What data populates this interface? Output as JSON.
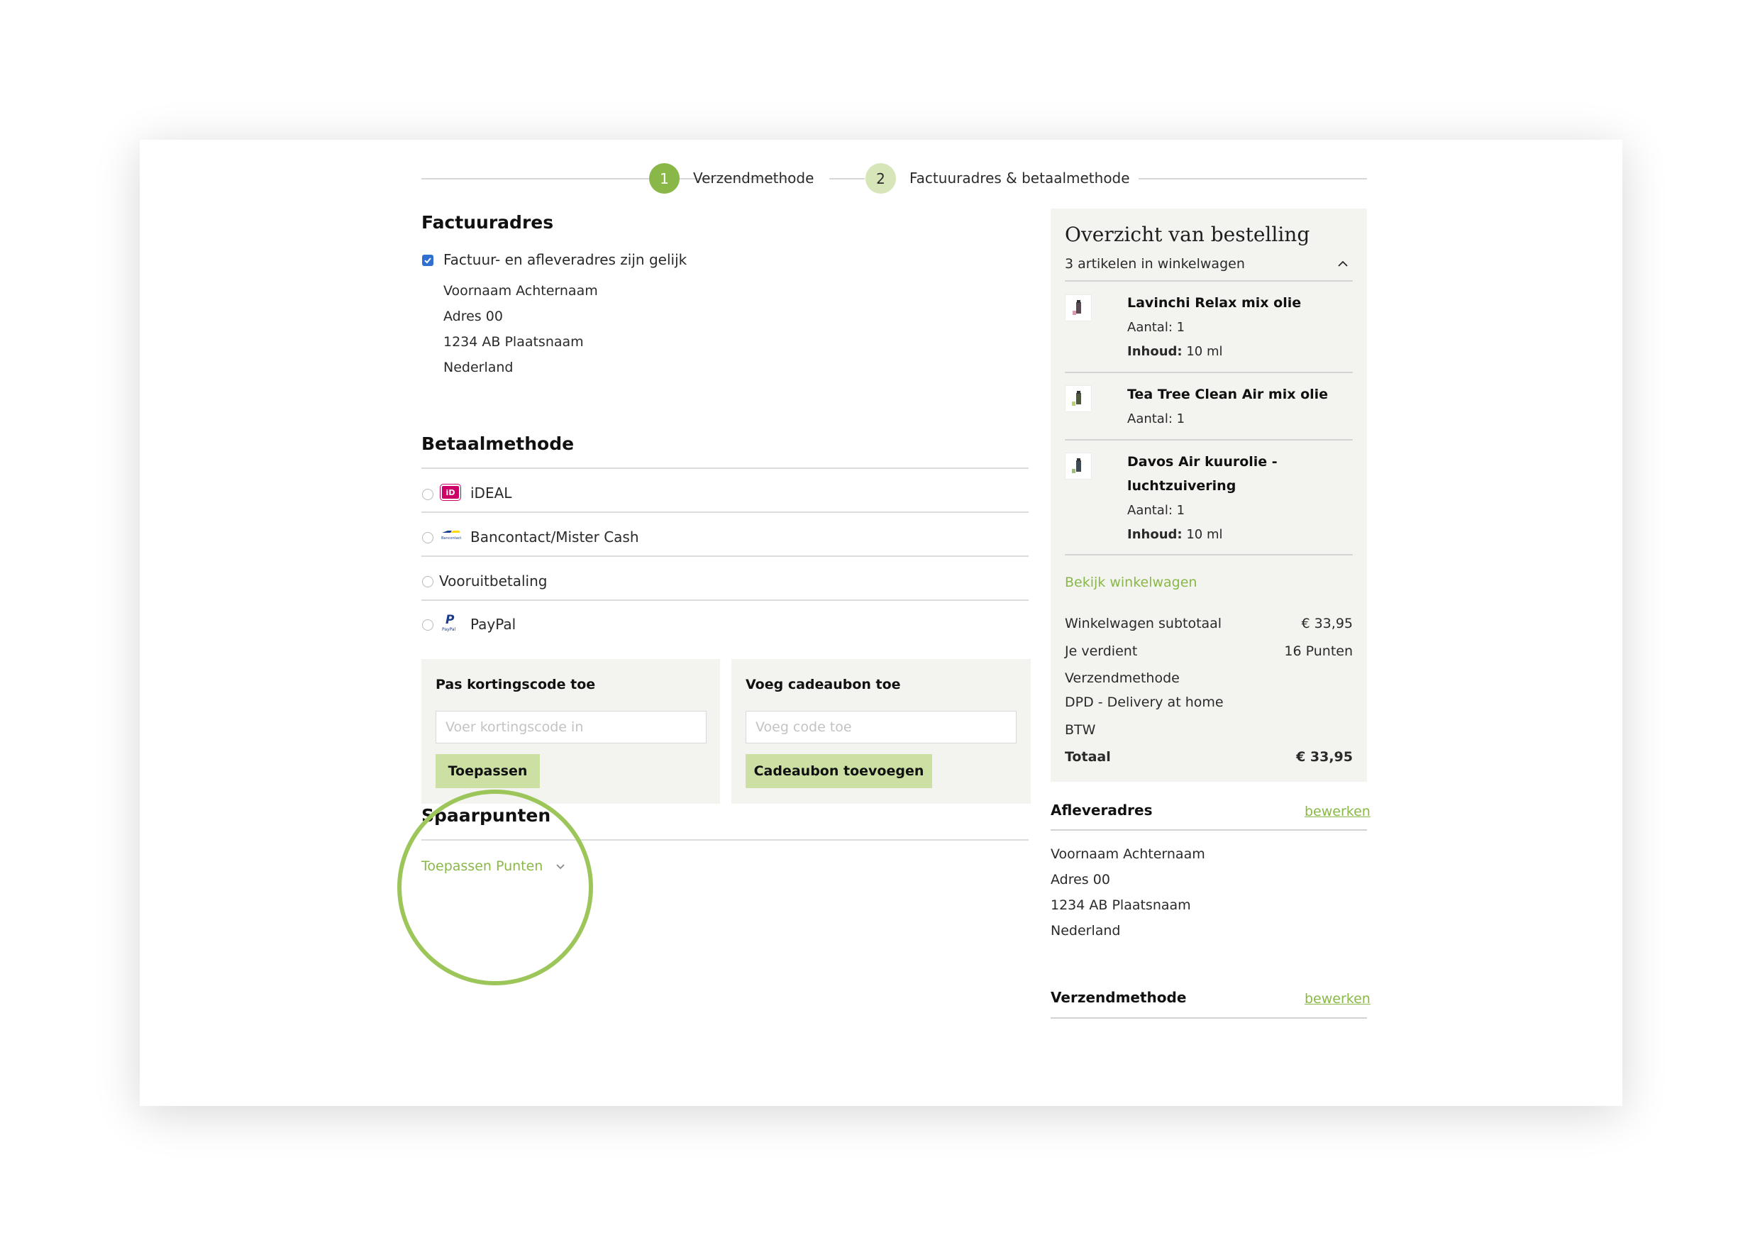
{
  "colors": {
    "accent": "#8ab848",
    "accent_light": "#cde0a4",
    "panel": "#f3f3f0",
    "checkbox": "#2f6fd1"
  },
  "progress": {
    "steps": [
      {
        "number": "1",
        "label": "Verzendmethode"
      },
      {
        "number": "2",
        "label": "Factuuradres & betaalmethode"
      }
    ]
  },
  "billing": {
    "title": "Factuuradres",
    "same_address_label": "Factuur- en afleveradres zijn gelijk",
    "address": [
      "Voornaam Achternaam",
      "Adres 00",
      "1234 AB Plaatsnaam",
      "Nederland"
    ]
  },
  "payment": {
    "title": "Betaalmethode",
    "methods": [
      {
        "label": "iDEAL",
        "icon": "ideal-icon"
      },
      {
        "label": "Bancontact/Mister Cash",
        "icon": "bancontact-icon"
      },
      {
        "label": "Vooruitbetaling",
        "icon": ""
      },
      {
        "label": "PayPal",
        "icon": "paypal-icon"
      }
    ],
    "icon_text": {
      "ideal": "iD",
      "bancontact": "Bancontact",
      "paypal_brand": "P",
      "paypal_text": "PayPal"
    }
  },
  "discount": {
    "title": "Pas kortingscode toe",
    "placeholder": "Voer kortingscode in",
    "button": "Toepassen"
  },
  "giftcard": {
    "title": "Voeg cadeaubon toe",
    "placeholder": "Voeg code toe",
    "button": "Cadeaubon toevoegen"
  },
  "points": {
    "title": "Spaarpunten",
    "apply_label": "Toepassen Punten"
  },
  "summary": {
    "title": "Overzicht van bestelling",
    "items_count": "3 artikelen in winkelwagen",
    "items": [
      {
        "name_lines": [
          "Lavinchi Relax mix olie"
        ],
        "qty": "Aantal: 1",
        "content_label": "Inhoud:",
        "content_value": "10 ml"
      },
      {
        "name_lines": [
          "Tea Tree Clean Air mix olie"
        ],
        "qty": "Aantal: 1"
      },
      {
        "name_lines": [
          "Davos Air kuurolie -",
          "luchtzuivering"
        ],
        "qty": "Aantal: 1",
        "content_label": "Inhoud:",
        "content_value": "10 ml"
      }
    ],
    "view_cart": "Bekijk winkelwagen",
    "totals": {
      "subtotal_label": "Winkelwagen subtotaal",
      "subtotal_value": "€ 33,95",
      "earn_label": "Je verdient",
      "earn_value": "16 Punten",
      "shipping_label": "Verzendmethode",
      "shipping_value": "DPD - Delivery at home",
      "tax_label": "BTW",
      "total_label": "Totaal",
      "total_value": "€ 33,95"
    }
  },
  "shipping_address": {
    "title": "Afleveradres",
    "edit": "bewerken",
    "address": [
      "Voornaam Achternaam",
      "Adres 00",
      "1234 AB Plaatsnaam",
      "Nederland"
    ]
  },
  "shipping_method": {
    "title": "Verzendmethode",
    "edit": "bewerken"
  }
}
